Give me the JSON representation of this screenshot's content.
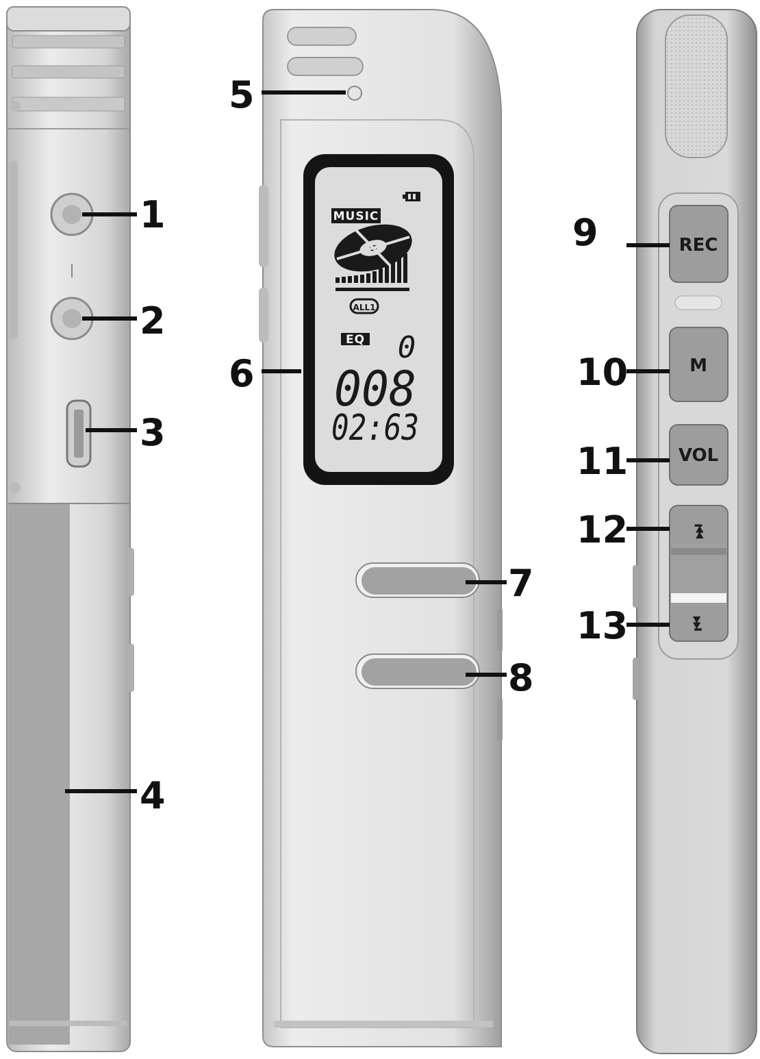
{
  "colors": {
    "body_light": "#e6e6e6",
    "body_mid": "#cfcfcf",
    "body_dark": "#a8a8a8",
    "button": "#9d9d9d",
    "lcd_bezel": "#141414",
    "lcd_screen": "#d9d9d9",
    "ink": "#111111"
  },
  "callouts": [
    "1",
    "2",
    "3",
    "4",
    "5",
    "6",
    "7",
    "8",
    "9",
    "10",
    "11",
    "12",
    "13"
  ],
  "lcd": {
    "mode_tag": "MUSIC",
    "repeat_tag": "ALL1",
    "eq_tag": "EQ",
    "eq_value": "0",
    "track_number": "008",
    "time": "02:63",
    "battery_icon": "battery-icon",
    "disc_icon": "disc-icon"
  },
  "buttons": {
    "rec": "REC",
    "menu": "M",
    "vol": "VOL",
    "prev_glyph": "⏮",
    "next_glyph": "⏭"
  }
}
